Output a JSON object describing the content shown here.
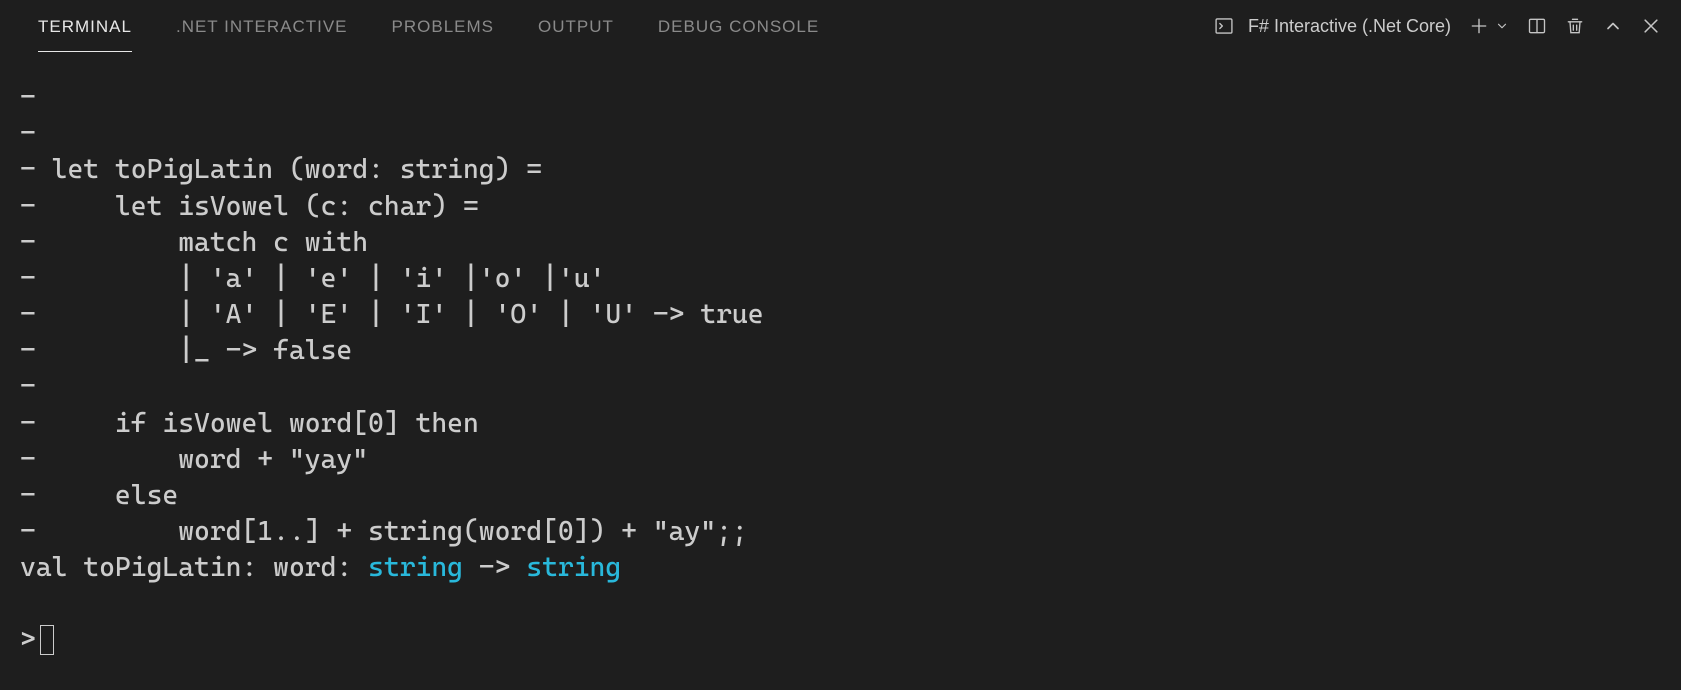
{
  "tabs": {
    "terminal": "TERMINAL",
    "dotnet": ".NET INTERACTIVE",
    "problems": "PROBLEMS",
    "output": "OUTPUT",
    "debug": "DEBUG CONSOLE"
  },
  "toolbar": {
    "shell_name": "F# Interactive (.Net Core)"
  },
  "terminal": {
    "lines": [
      "- ",
      "- ",
      "- let toPigLatin (word: string) =",
      "-     let isVowel (c: char) =",
      "-         match c with",
      "-         | 'a' | 'e' | 'i' |'o' |'u'",
      "-         | 'A' | 'E' | 'I' | 'O' | 'U' -> true",
      "-         |_ -> false",
      "- ",
      "-     if isVowel word[0] then",
      "-         word + \"yay\"",
      "-     else",
      "-         word[1..] + string(word[0]) + \"ay\";;"
    ],
    "val_prefix": "val toPigLatin: word: ",
    "val_t1": "string",
    "val_arrow": " -> ",
    "val_t2": "string",
    "prompt": "> "
  }
}
